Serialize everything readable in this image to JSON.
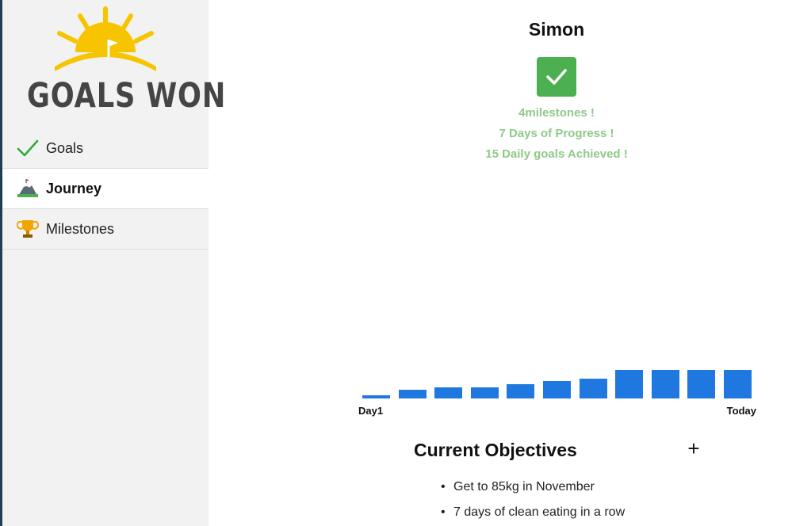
{
  "logo": {
    "text": "GOALS WON"
  },
  "sidebar": {
    "items": [
      {
        "label": "Goals",
        "icon": "check-icon",
        "active": false
      },
      {
        "label": "Journey",
        "icon": "mountain-icon",
        "active": true
      },
      {
        "label": "Milestones",
        "icon": "trophy-icon",
        "active": false
      }
    ]
  },
  "profile": {
    "name": "Simon",
    "stats": [
      "4milestones !",
      "7 Days of Progress !",
      "15 Daily goals Achieved !"
    ]
  },
  "chart_data": {
    "type": "bar",
    "categories": [
      "Day1",
      "",
      "",
      "",
      "",
      "",
      "",
      "",
      "",
      "",
      "Today"
    ],
    "values": [
      1,
      3,
      4,
      4,
      5,
      6,
      7,
      10,
      10,
      10,
      10
    ],
    "ylim": [
      0,
      10
    ],
    "color": "#1f77e0"
  },
  "objectives": {
    "title": "Current Objectives",
    "add_label": "+",
    "items": [
      "Get to 85kg in November",
      "7 days of clean eating in a row"
    ]
  },
  "colors": {
    "accent_green": "#4caf50",
    "stat_text": "#90c98a",
    "bar_blue": "#1f77e0",
    "sun_yellow": "#f7c400"
  }
}
